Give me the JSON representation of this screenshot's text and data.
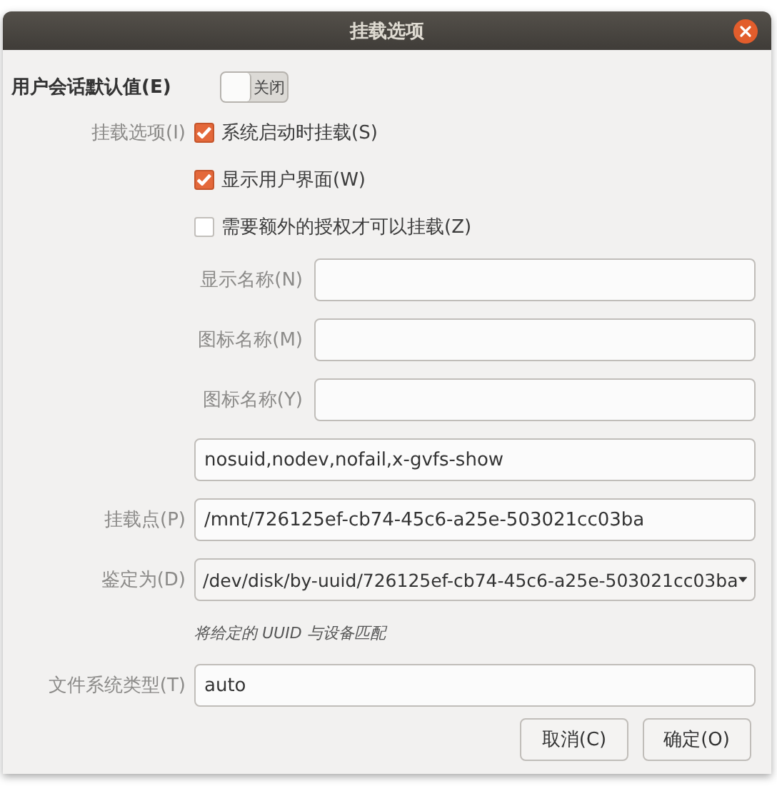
{
  "window": {
    "title": "挂载选项"
  },
  "user_session_defaults": {
    "label": "用户会话默认值(E)",
    "on": false,
    "state_label": "关闭"
  },
  "mount_options": {
    "label": "挂载选项(I)",
    "checkboxes": [
      {
        "label": "系统启动时挂载(S)",
        "checked": true
      },
      {
        "label": "显示用户界面(W)",
        "checked": true
      },
      {
        "label": "需要额外的授权才可以挂载(Z)",
        "checked": false
      }
    ]
  },
  "fields": [
    {
      "kind": "name_entry",
      "label": "显示名称(N)"
    },
    {
      "kind": "name_entry",
      "label": "图标名称(M)"
    },
    {
      "kind": "name_entry",
      "label": "图标名称(Y)"
    },
    {
      "kind": "entry",
      "value": "nosuid,nodev,nofail,x-gvfs-show"
    },
    {
      "kind": "entry",
      "label": "挂载点(P)",
      "value": "/mnt/726125ef-cb74-45c6-a25e-503021cc03ba"
    },
    {
      "kind": "dropdown",
      "label": "鉴定为(D)",
      "value": "/dev/disk/by-uuid/726125ef-cb74-45c6-a25e-503021cc03ba"
    },
    {
      "kind": "hint",
      "text": "将给定的 UUID 与设备匹配"
    },
    {
      "kind": "entry",
      "label": "文件系统类型(T)",
      "value": "auto"
    }
  ],
  "buttons": [
    "取消(C)",
    "确定(O)"
  ]
}
